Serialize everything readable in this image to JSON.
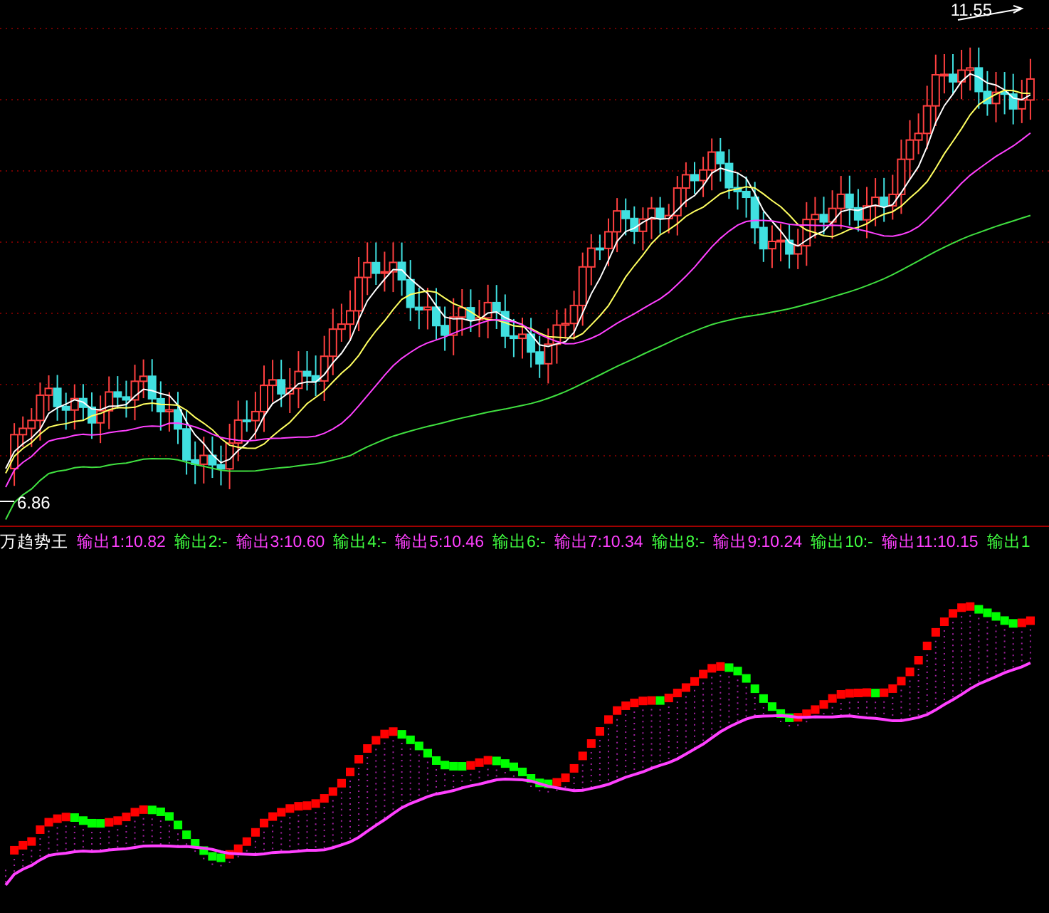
{
  "price_chart": {
    "high_label": "11.55",
    "low_label": "6.86"
  },
  "indicator": {
    "name": "万趋势王",
    "outputs": [
      {
        "label": "输出1:10.82",
        "kind": "value"
      },
      {
        "label": "输出2:-",
        "kind": "empty"
      },
      {
        "label": "输出3:10.60",
        "kind": "value"
      },
      {
        "label": "输出4:-",
        "kind": "empty"
      },
      {
        "label": "输出5:10.46",
        "kind": "value"
      },
      {
        "label": "输出6:-",
        "kind": "empty"
      },
      {
        "label": "输出7:10.34",
        "kind": "value"
      },
      {
        "label": "输出8:-",
        "kind": "empty"
      },
      {
        "label": "输出9:10.24",
        "kind": "value"
      },
      {
        "label": "输出10:-",
        "kind": "empty"
      },
      {
        "label": "输出11:10.15",
        "kind": "value"
      },
      {
        "label": "输出1",
        "kind": "empty"
      }
    ]
  }
}
